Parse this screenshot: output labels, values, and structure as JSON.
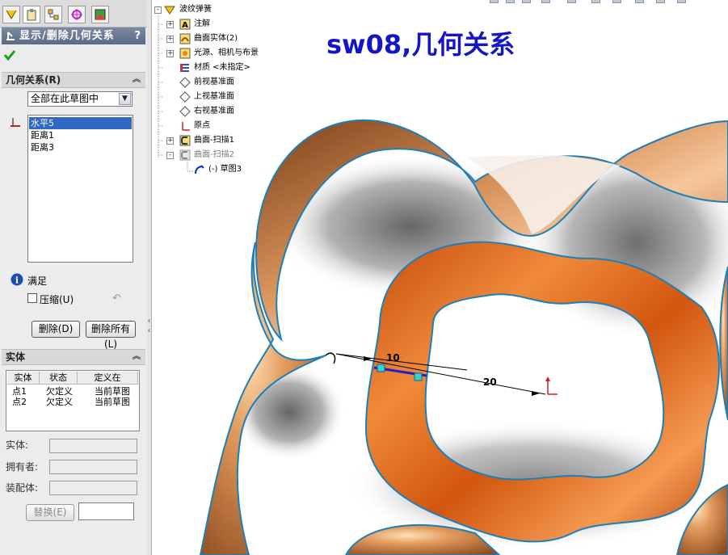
{
  "panel": {
    "title": "显示/删除几何关系",
    "help": "?",
    "relations_section": {
      "title": "几何关系(R)",
      "filter_value": "全部在此草图中",
      "items": [
        "水平5",
        "距离1",
        "距离3"
      ],
      "selected_index": 0,
      "status_text": "满足",
      "suppress_label": "压缩(U)",
      "delete_button": "删除(D)",
      "delete_all_button": "删除所有(L)"
    },
    "entities_section": {
      "title": "实体",
      "columns": [
        "实体",
        "状态",
        "定义在"
      ],
      "rows": [
        [
          "点1",
          "欠定义",
          "当前草图"
        ],
        [
          "点2",
          "欠定义",
          "当前草图"
        ]
      ],
      "entity_label": "实体:",
      "owner_label": "拥有者:",
      "assembly_label": "装配体:",
      "replace_button": "替换(E)"
    }
  },
  "tree": {
    "root": "波纹弹簧",
    "items": [
      {
        "label": "注解",
        "expand": "+"
      },
      {
        "label": "曲面实体(2)",
        "expand": "+"
      },
      {
        "label": "光源、相机与布景",
        "expand": "+"
      },
      {
        "label": "材质 <未指定>",
        "expand": ""
      },
      {
        "label": "前视基准面",
        "expand": ""
      },
      {
        "label": "上视基准面",
        "expand": ""
      },
      {
        "label": "右视基准面",
        "expand": ""
      },
      {
        "label": "原点",
        "expand": ""
      },
      {
        "label": "曲面-扫描1",
        "expand": "+"
      },
      {
        "label": "曲面-扫描2",
        "expand": "-"
      }
    ],
    "sketch_item": "(-) 草图3"
  },
  "viewport": {
    "title": "sw08,几何关系",
    "dim_small": "10",
    "dim_large": "20"
  },
  "colors": {
    "title_blue": "#1515c8",
    "copper": "#c97a3f",
    "orange_ring": "#d9621a",
    "edge_blue": "#1e7fb8",
    "selection": "#3168c5"
  }
}
